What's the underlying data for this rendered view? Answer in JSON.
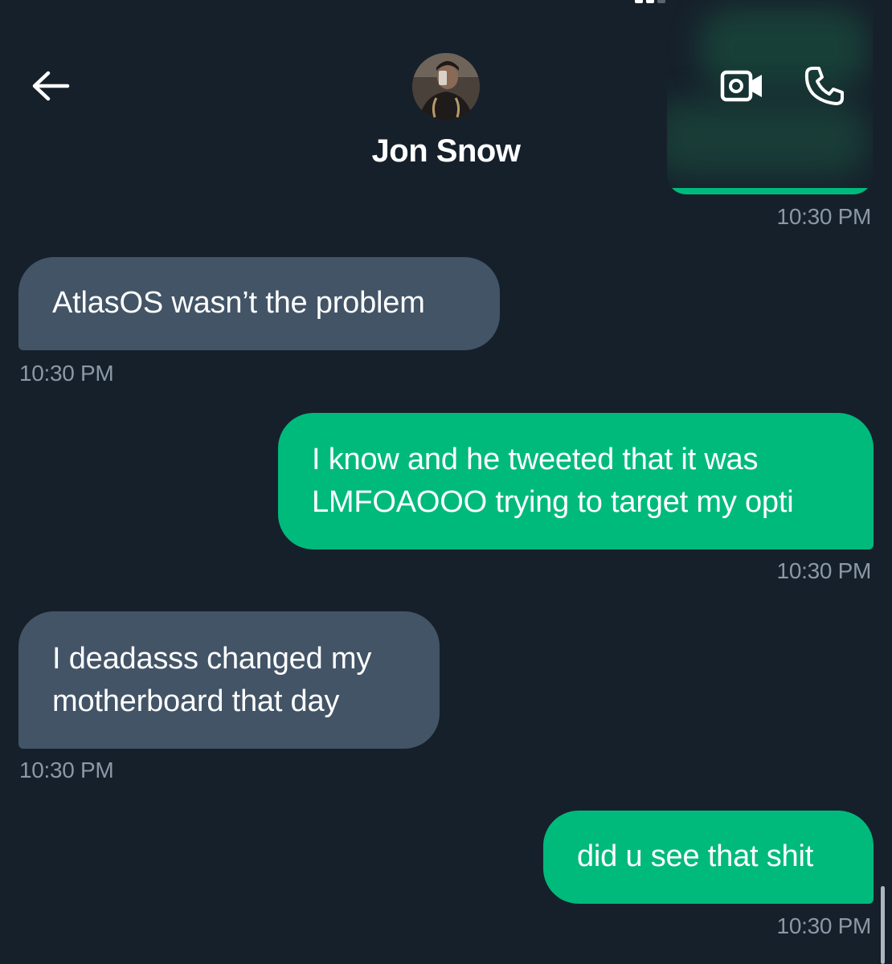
{
  "header": {
    "contact_name": "Jon Snow"
  },
  "icons": {
    "back": "arrow-left-icon",
    "video_call": "video-camera-icon",
    "voice_call": "phone-icon"
  },
  "colors": {
    "background": "#16202b",
    "incoming_bubble": "#425466",
    "outgoing_bubble": "#00ba7c",
    "timestamp": "#8b98a5"
  },
  "messages": [
    {
      "direction": "outgoing",
      "text": "",
      "time": "10:30 PM",
      "blurred": true
    },
    {
      "direction": "incoming",
      "text": "AtlasOS wasn’t the problem",
      "time": "10:30 PM"
    },
    {
      "direction": "outgoing",
      "lines": [
        "I know and he tweeted that it was",
        "LMFOAOOO trying to target my opti"
      ],
      "time": "10:30 PM"
    },
    {
      "direction": "incoming",
      "lines": [
        "I deadasss changed my",
        "motherboard that day"
      ],
      "time": "10:30 PM"
    },
    {
      "direction": "outgoing",
      "text": "did u see that shit",
      "time": "10:30 PM"
    }
  ]
}
